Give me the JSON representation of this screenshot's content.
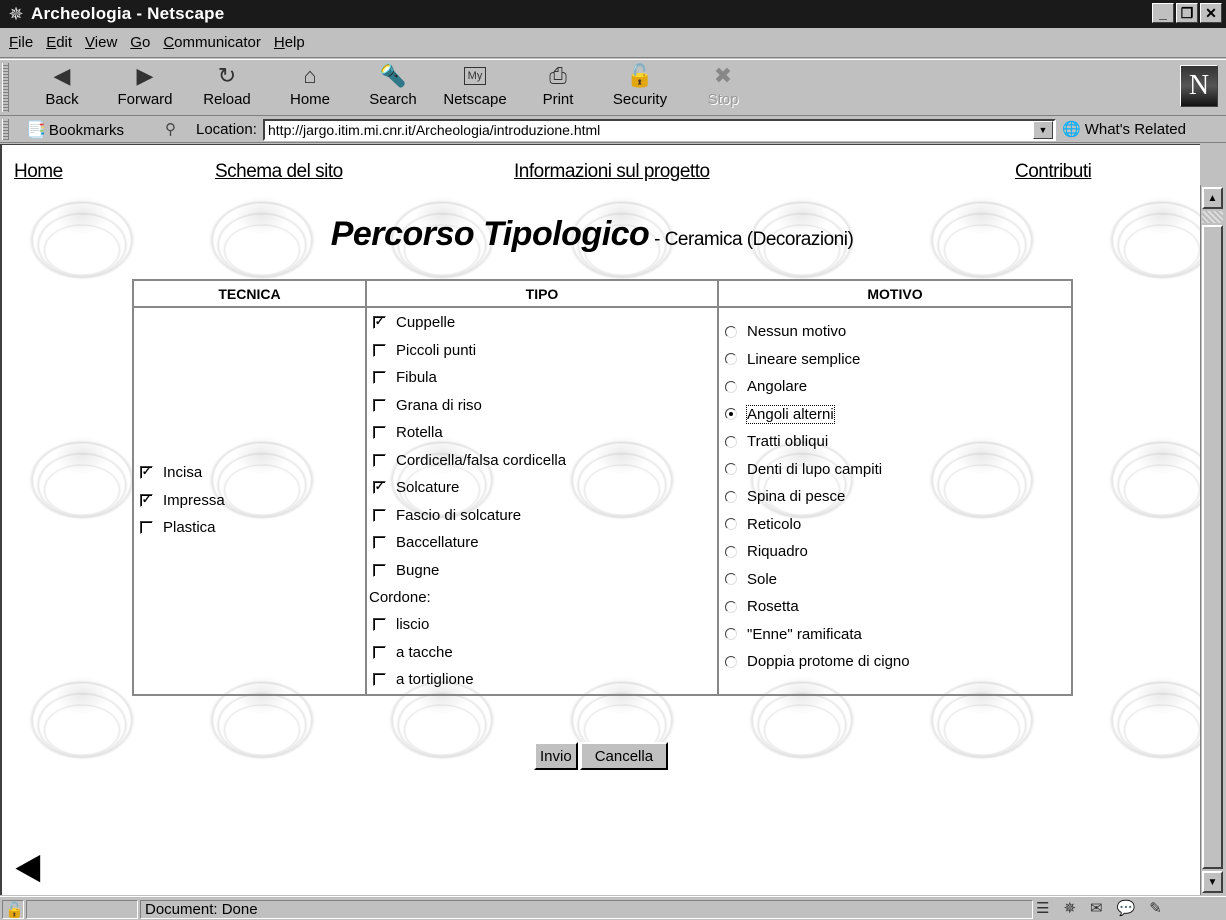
{
  "window": {
    "title": "Archeologia - Netscape",
    "controls": {
      "minimize": "_",
      "restore": "❐",
      "close": "✕"
    }
  },
  "menu": [
    {
      "label": "File",
      "accel": "F",
      "rest": "ile"
    },
    {
      "label": "Edit",
      "accel": "E",
      "rest": "dit"
    },
    {
      "label": "View",
      "accel": "V",
      "rest": "iew"
    },
    {
      "label": "Go",
      "accel": "G",
      "rest": "o"
    },
    {
      "label": "Communicator",
      "accel": "C",
      "rest": "ommunicator"
    },
    {
      "label": "Help",
      "accel": "H",
      "rest": "elp"
    }
  ],
  "toolbar": {
    "buttons": [
      {
        "label": "Back",
        "icon": "back-arrow-icon",
        "glyph": "◀",
        "enabled": true
      },
      {
        "label": "Forward",
        "icon": "forward-arrow-icon",
        "glyph": "▶",
        "enabled": true
      },
      {
        "label": "Reload",
        "icon": "reload-icon",
        "glyph": "↻",
        "enabled": true
      },
      {
        "label": "Home",
        "icon": "home-icon",
        "glyph": "⌂",
        "enabled": true
      },
      {
        "label": "Search",
        "icon": "search-flashlight-icon",
        "glyph": "🔦",
        "enabled": true
      },
      {
        "label": "Netscape",
        "icon": "my-netscape-icon",
        "glyph": "My",
        "enabled": true
      },
      {
        "label": "Print",
        "icon": "printer-icon",
        "glyph": "⎙",
        "enabled": true
      },
      {
        "label": "Security",
        "icon": "padlock-icon",
        "glyph": "🔓",
        "enabled": true
      },
      {
        "label": "Stop",
        "icon": "stop-icon",
        "glyph": "✖",
        "enabled": false
      }
    ],
    "logo": "N"
  },
  "location_bar": {
    "bookmarks_label": "Bookmarks",
    "location_label": "Location:",
    "url": "http://jargo.itim.mi.cnr.it/Archeologia/introduzione.html",
    "whats_related_label": "What's Related"
  },
  "page": {
    "nav_links": [
      "Home",
      "Schema del sito",
      "Informazioni sul progetto",
      "Contributi"
    ],
    "title": "Percorso Tipologico",
    "subtitle": " - Ceramica (Decorazioni)",
    "columns": {
      "tecnica": {
        "header": "TECNICA",
        "options": [
          {
            "label": "Incisa",
            "checked": true
          },
          {
            "label": "Impressa",
            "checked": true
          },
          {
            "label": "Plastica",
            "checked": false
          }
        ]
      },
      "tipo": {
        "header": "TIPO",
        "options": [
          {
            "label": "Cuppelle",
            "checked": true
          },
          {
            "label": "Piccoli punti",
            "checked": false
          },
          {
            "label": "Fibula",
            "checked": false
          },
          {
            "label": "Grana di riso",
            "checked": false
          },
          {
            "label": "Rotella",
            "checked": false
          },
          {
            "label": "Cordicella/falsa cordicella",
            "checked": false
          },
          {
            "label": "Solcature",
            "checked": true
          },
          {
            "label": "Fascio di solcature",
            "checked": false
          },
          {
            "label": "Baccellature",
            "checked": false
          },
          {
            "label": "Bugne",
            "checked": false
          }
        ],
        "group_label": "Cordone:",
        "group_options": [
          {
            "label": "liscio",
            "checked": false
          },
          {
            "label": "a tacche",
            "checked": false
          },
          {
            "label": "a tortiglione",
            "checked": false
          }
        ]
      },
      "motivo": {
        "header": "MOTIVO",
        "selected": "Angoli alterni",
        "options": [
          "Nessun motivo",
          "Lineare semplice",
          "Angolare",
          "Angoli alterni",
          "Tratti obliqui",
          "Denti di lupo campiti",
          "Spina di pesce",
          "Reticolo",
          "Riquadro",
          "Sole",
          "Rosetta",
          "\"Enne\" ramificata",
          "Doppia protome di cigno"
        ]
      }
    },
    "submit_label": "Invio",
    "reset_label": "Cancella"
  },
  "status": {
    "text": "Document: Done"
  }
}
